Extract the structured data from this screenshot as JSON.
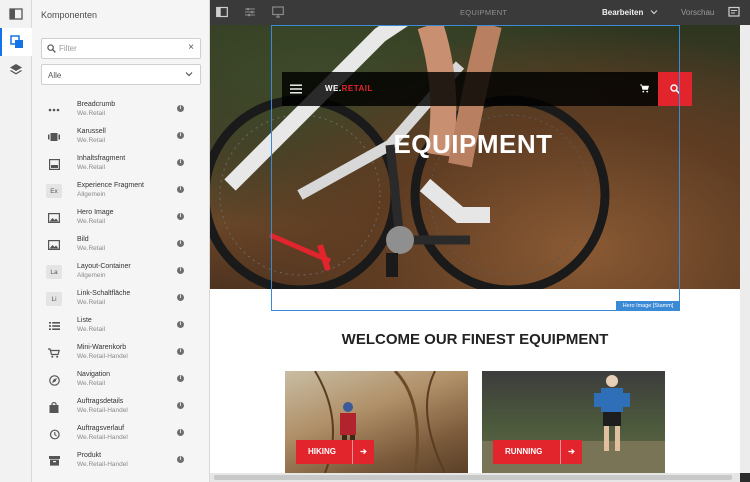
{
  "sidebar": {
    "title": "Komponenten",
    "filter_placeholder": "Filter",
    "group_select": "Alle",
    "items": [
      {
        "name": "Breadcrumb",
        "group": "We.Retail",
        "icon": "dots-icon"
      },
      {
        "name": "Karussell",
        "group": "We.Retail",
        "icon": "carousel-icon"
      },
      {
        "name": "Inhaltsfragment",
        "group": "We.Retail",
        "icon": "fragment-icon"
      },
      {
        "name": "Experience Fragment",
        "group": "Allgemein",
        "icon": "badge-icon",
        "badge": "Ex"
      },
      {
        "name": "Hero Image",
        "group": "We.Retail",
        "icon": "image-icon"
      },
      {
        "name": "Bild",
        "group": "We.Retail",
        "icon": "image-icon"
      },
      {
        "name": "Layout-Container",
        "group": "Allgemein",
        "icon": "badge-icon",
        "badge": "La"
      },
      {
        "name": "Link-Schaltfläche",
        "group": "We.Retail",
        "icon": "badge-icon",
        "badge": "Li"
      },
      {
        "name": "Liste",
        "group": "We.Retail",
        "icon": "list-icon"
      },
      {
        "name": "Mini-Warenkorb",
        "group": "We.Retail-Handel",
        "icon": "cart-icon"
      },
      {
        "name": "Navigation",
        "group": "We.Retail",
        "icon": "compass-icon"
      },
      {
        "name": "Auftragsdetails",
        "group": "We.Retail-Handel",
        "icon": "bag-icon"
      },
      {
        "name": "Auftragsverlauf",
        "group": "We.Retail-Handel",
        "icon": "history-icon"
      },
      {
        "name": "Produkt",
        "group": "We.Retail-Handel",
        "icon": "box-icon"
      }
    ]
  },
  "toolbar": {
    "page_title": "EQUIPMENT",
    "mode": "Bearbeiten",
    "preview": "Vorschau"
  },
  "canvas": {
    "logo_main": "WE.",
    "logo_accent": "RETAIL",
    "hero_title": "EQUIPMENT",
    "selection_label": "Hero Image [Stamm]",
    "welcome": "WELCOME OUR FINEST EQUIPMENT",
    "cards": [
      {
        "label": "HIKING"
      },
      {
        "label": "RUNNING"
      }
    ]
  },
  "colors": {
    "accent": "#e2242d",
    "selection": "#3b8ad6"
  }
}
